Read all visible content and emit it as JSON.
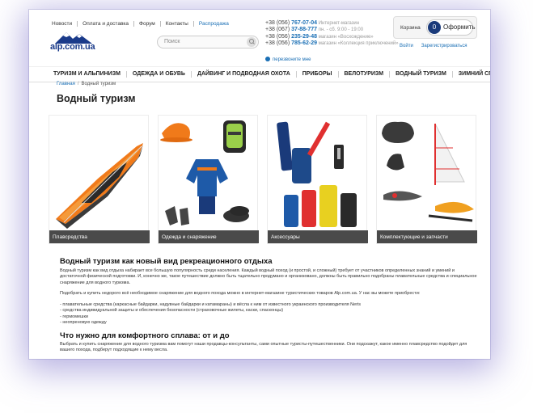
{
  "header": {
    "top_links": [
      "Новости",
      "Оплата и доставка",
      "Форум",
      "Контакты",
      "Распродажа"
    ],
    "logo_text": "alp.com.ua",
    "search_placeholder": "Поиск",
    "phones": [
      {
        "prefix": "+38 (056) ",
        "number": "767-07-04",
        "note": " Интернет-магазин"
      },
      {
        "prefix": "+38 (067) ",
        "number": "37-88-777",
        "note": " пн. - сб. 9:00 - 19:00"
      },
      {
        "prefix": "+38 (056) ",
        "number": "235-29-48",
        "note": " магазин «Восхождение»"
      },
      {
        "prefix": "+38 (056) ",
        "number": "785-62-29",
        "note": " магазин «Коллекция приключений»"
      }
    ],
    "callback_label": "перезвоните мне",
    "cart": {
      "label": "Корзина",
      "count": "0",
      "order_label": "Оформить"
    },
    "login_label": "Войти",
    "register_label": "Зарегистрироваться"
  },
  "menu": [
    "ТУРИЗМ И АЛЬПИНИЗМ",
    "ОДЕЖДА И ОБУВЬ",
    "ДАЙВИНГ И ПОДВОДНАЯ ОХОТА",
    "ПРИБОРЫ",
    "ВЕЛОТУРИЗМ",
    "ВОДНЫЙ ТУРИЗМ",
    "ЗИМНИЙ СПОРТ"
  ],
  "breadcrumb": {
    "home": "Главная",
    "separator": "/",
    "current": "Водный туризм"
  },
  "page_title": "Водный туризм",
  "categories": [
    {
      "label": "Плавсредства",
      "image": "kayak-image"
    },
    {
      "label": "Одежда и снаряжение",
      "image": "gear-image"
    },
    {
      "label": "Аксессуары",
      "image": "bags-image"
    },
    {
      "label": "Комплектующие и запчасти",
      "image": "parts-image"
    }
  ],
  "article": {
    "h1": "Водный туризм как новый вид рекреационного отдыха",
    "p1": "Водный туризм как вид отдыха набирает все большую популярность среди населения. Каждый водный поход (и простой, и сложный) требует от участников определенных знаний и умений и достаточной физической подготовки. И, конечно же, такое путешествие должно быть тщательно продумано и организовано, должны быть правильно подобраны плавательные средства и специальное снаряжение для водного туризма.",
    "p2": "Подобрать и купить недорого всё необходимое снаряжение для водного похода можно в интернет-магазине туристических товаров Alp.com.ua. У нас вы можете приобрести:",
    "list": [
      "- плавательные средства (каркасные байдарки, надувные байдарки и катамараны) и вёсла к ним от известного украинского производителя Neris",
      "- средства индивидуальной защиты и обеспечения безопасности (страховочные жилеты, каски, спасконцы)",
      "- гермомешки",
      "- неопреновую одежду"
    ],
    "h2": "Что нужно для комфортного сплава: от и до",
    "p3": "Выбрать и купить снаряжение для водного туризма вам помогут наши продавцы-консультанты, сами опытные туристы-путешественники. Они подскажут, какое именно плавсредство подойдет для вашего похода, подберут подходящие к нему весла."
  }
}
